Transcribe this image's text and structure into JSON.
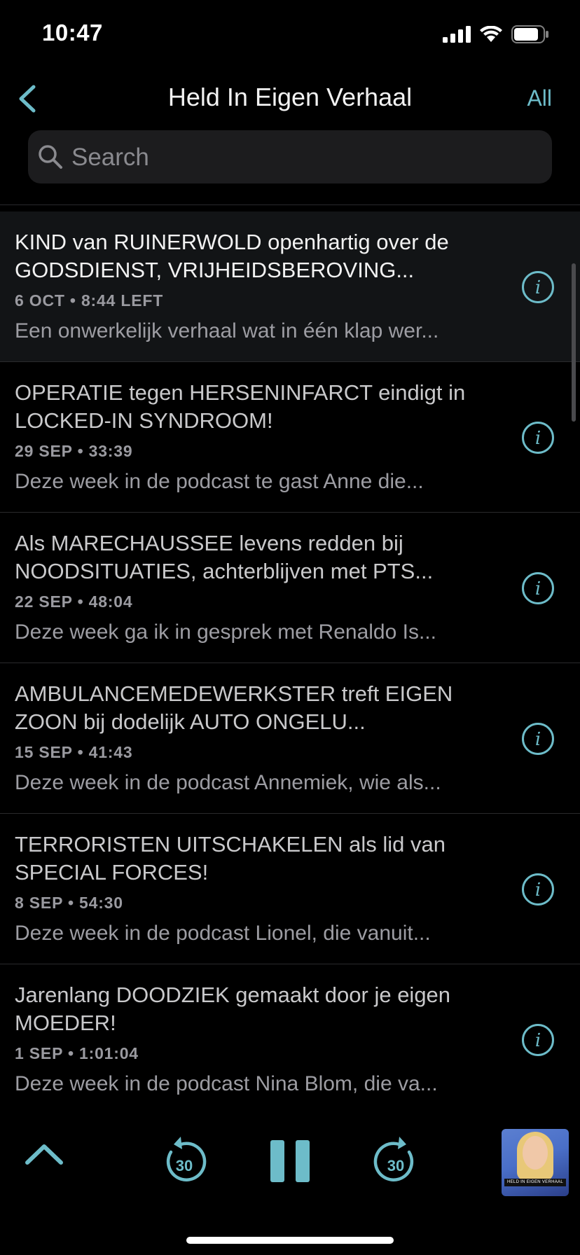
{
  "status": {
    "time": "10:47"
  },
  "nav": {
    "title": "Held In Eigen Verhaal",
    "all_label": "All"
  },
  "search": {
    "placeholder": "Search"
  },
  "episodes": [
    {
      "title": "KIND van RUINERWOLD openhartig over de GODSDIENST, VRIJHEIDSBEROVING...",
      "meta": "6 OCT • 8:44 LEFT",
      "desc": "Een onwerkelijk verhaal wat in één klap wer...",
      "active": true
    },
    {
      "title": "OPERATIE tegen HERSENINFARCT eindigt in LOCKED-IN SYNDROOM!",
      "meta": "29 SEP • 33:39",
      "desc": "Deze week in de podcast te gast Anne die..."
    },
    {
      "title": "Als MARECHAUSSEE levens redden bij NOODSITUATIES, achterblijven met PTS...",
      "meta": "22 SEP • 48:04",
      "desc": "Deze week ga ik in gesprek met Renaldo Is..."
    },
    {
      "title": "AMBULANCEMEDEWERKSTER treft EIGEN ZOON bij dodelijk AUTO ONGELU...",
      "meta": "15 SEP • 41:43",
      "desc": "Deze week in de podcast Annemiek, wie als..."
    },
    {
      "title": "TERRORISTEN UITSCHAKELEN als lid van SPECIAL FORCES!",
      "meta": "8 SEP • 54:30",
      "desc": "Deze week in de podcast Lionel, die vanuit..."
    },
    {
      "title": "Jarenlang DOODZIEK gemaakt door je eigen MOEDER!",
      "meta": "1 SEP • 1:01:04",
      "desc": "Deze week in de podcast Nina Blom, die va..."
    }
  ],
  "player": {
    "skip_back_seconds": "30",
    "skip_forward_seconds": "30",
    "artwork_text": "HELD IN EIGEN VERHAAL"
  },
  "colors": {
    "accent": "#6dbcc9",
    "background": "#000000"
  },
  "icons": [
    "back-chevron-icon",
    "search-icon",
    "info-icon",
    "chevron-up-icon",
    "skip-back-30-icon",
    "pause-icon",
    "skip-forward-30-icon"
  ]
}
